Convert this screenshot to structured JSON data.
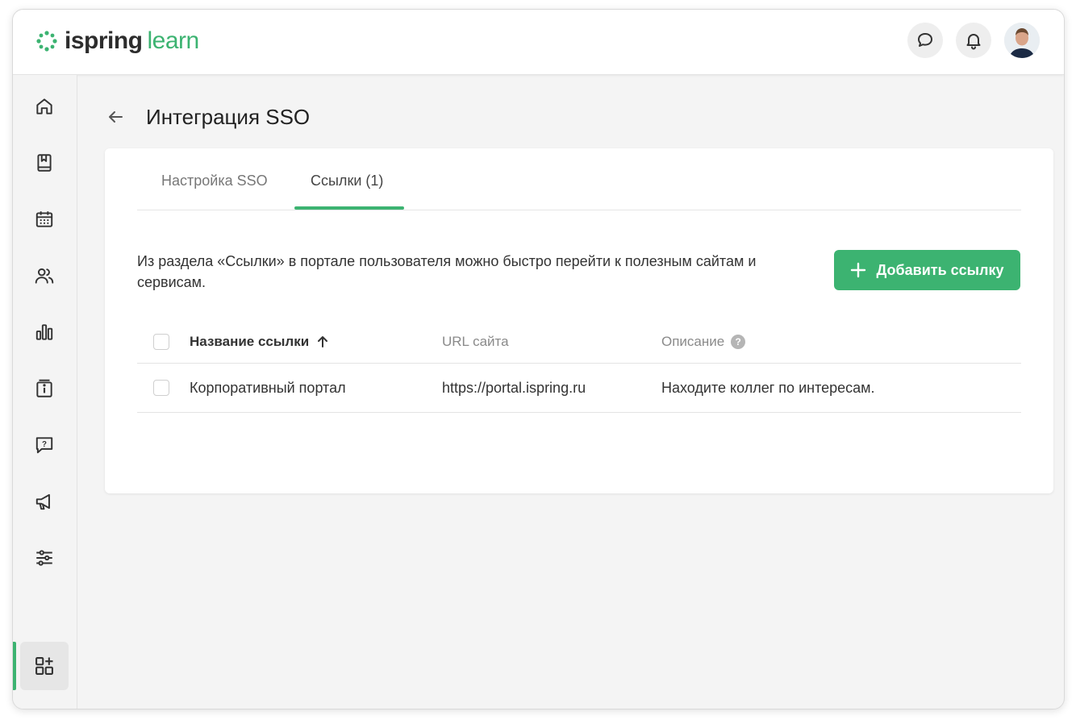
{
  "app": {
    "logo_text_main": "ispring",
    "logo_text_sub": "learn",
    "accent_color": "#3cb371"
  },
  "topbar": {
    "icons": [
      "chat-icon",
      "bell-icon",
      "user-avatar"
    ]
  },
  "sidebar": {
    "items": [
      {
        "icon": "home-icon"
      },
      {
        "icon": "book-icon"
      },
      {
        "icon": "calendar-icon"
      },
      {
        "icon": "users-icon"
      },
      {
        "icon": "reports-icon"
      },
      {
        "icon": "info-catalog-icon"
      },
      {
        "icon": "help-question-icon"
      },
      {
        "icon": "megaphone-icon"
      },
      {
        "icon": "settings-sliders-icon"
      },
      {
        "icon": "apps-add-icon",
        "active": true
      }
    ]
  },
  "page": {
    "title": "Интеграция SSO"
  },
  "tabs": [
    {
      "label": "Настройка SSO"
    },
    {
      "label": "Ссылки (1)",
      "active": true
    }
  ],
  "links_section": {
    "description": "Из раздела «Ссылки» в портале пользователя можно быстро перейти к полезным сайтам и сервисам.",
    "add_button_label": "Добавить ссылку"
  },
  "table": {
    "columns": {
      "name": "Название ссылки",
      "url": "URL сайта",
      "description": "Описание",
      "help_mark": "?"
    },
    "rows": [
      {
        "name": "Корпоративный портал",
        "url": "https://portal.ispring.ru",
        "description": "Находите коллег по интересам."
      }
    ]
  }
}
